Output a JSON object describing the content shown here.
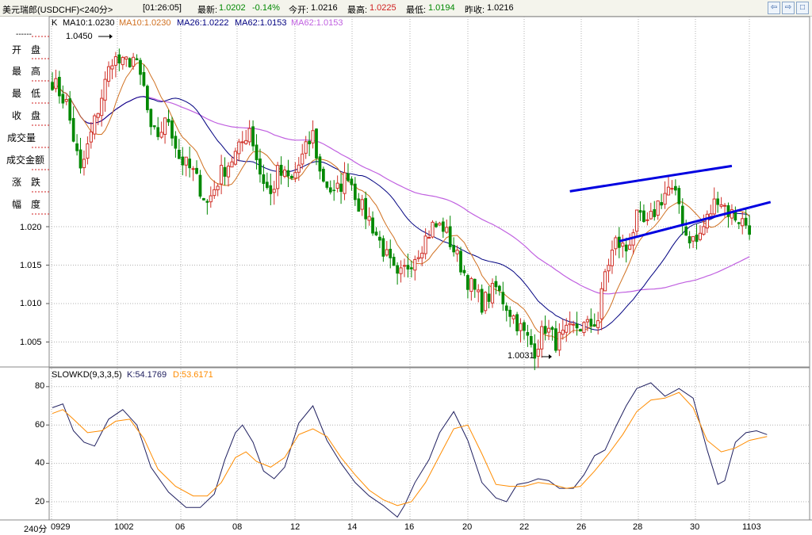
{
  "header": {
    "symbol": "美元瑞郎(USDCHF)<240分>",
    "time": "[01:26:05]",
    "latest_label": "最新:",
    "latest_value": "1.0202",
    "change": "-0.14%",
    "open_label": "今开:",
    "open_value": "1.0216",
    "high_label": "最高:",
    "high_value": "1.0225",
    "low_label": "最低:",
    "low_value": "1.0194",
    "prevclose_label": "昨收:",
    "prevclose_value": "1.0216"
  },
  "toolbar": {
    "btn1": "⇦",
    "btn2": "⇨",
    "btn3": "□"
  },
  "left_panel": {
    "dash": "------",
    "items": [
      "开　盘",
      "最　高",
      "最　低",
      "收　盘",
      "成交量",
      "成交金额",
      "涨　跌",
      "幅　度"
    ]
  },
  "ma_legend": {
    "k": "K",
    "ma10a": "MA10:1.0230",
    "ma10b": "MA10:1.0230",
    "ma26": "MA26:1.0222",
    "ma62a": "MA62:1.0153",
    "ma62b": "MA62:1.0153"
  },
  "price_annotations": {
    "high": "1.0450",
    "low": "1.0031"
  },
  "kd_legend": {
    "name": "SLOWKD(9,3,3,5)",
    "k": "K:54.1769",
    "d": "D:53.6171"
  },
  "bottom_left": "240分",
  "colors": {
    "up": "#d03028",
    "down": "#008800",
    "ma10": "#d07020",
    "ma26": "#000080",
    "ma62": "#c060e0",
    "kline": "#202060",
    "dline": "#ff8c00",
    "trendline": "#0000e0",
    "grid": "#b0b0b0"
  },
  "chart_data": [
    {
      "type": "candlestick",
      "title": "USDCHF 240分",
      "ylim": [
        1.0,
        1.047
      ],
      "yticks": [
        "1.020",
        "1.015",
        "1.010",
        "1.005"
      ],
      "xticks": [
        "0929",
        "1002",
        "06",
        "08",
        "12",
        "14",
        "16",
        "20",
        "22",
        "26",
        "28",
        "30",
        "1103"
      ],
      "waypoints": [
        {
          "i": 0,
          "c": 1.039
        },
        {
          "i": 4,
          "c": 1.036
        },
        {
          "i": 8,
          "c": 1.027
        },
        {
          "i": 11,
          "c": 1.032
        },
        {
          "i": 14,
          "c": 1.037
        },
        {
          "i": 17,
          "c": 1.042
        },
        {
          "i": 20,
          "c": 1.041
        },
        {
          "i": 23,
          "c": 1.042
        },
        {
          "i": 26,
          "c": 1.038
        },
        {
          "i": 28,
          "c": 1.032
        },
        {
          "i": 30,
          "c": 1.032
        },
        {
          "i": 33,
          "c": 1.034
        },
        {
          "i": 36,
          "c": 1.029
        },
        {
          "i": 40,
          "c": 1.027
        },
        {
          "i": 44,
          "c": 1.023
        },
        {
          "i": 48,
          "c": 1.027
        },
        {
          "i": 53,
          "c": 1.03
        },
        {
          "i": 56,
          "c": 1.033
        },
        {
          "i": 59,
          "c": 1.027
        },
        {
          "i": 62,
          "c": 1.024
        },
        {
          "i": 64,
          "c": 1.027
        },
        {
          "i": 68,
          "c": 1.026
        },
        {
          "i": 72,
          "c": 1.03
        },
        {
          "i": 74,
          "c": 1.032
        },
        {
          "i": 76,
          "c": 1.027
        },
        {
          "i": 80,
          "c": 1.024
        },
        {
          "i": 84,
          "c": 1.027
        },
        {
          "i": 87,
          "c": 1.023
        },
        {
          "i": 90,
          "c": 1.021
        },
        {
          "i": 94,
          "c": 1.017
        },
        {
          "i": 98,
          "c": 1.013
        },
        {
          "i": 101,
          "c": 1.015
        },
        {
          "i": 104,
          "c": 1.017
        },
        {
          "i": 108,
          "c": 1.02
        },
        {
          "i": 111,
          "c": 1.02
        },
        {
          "i": 115,
          "c": 1.016
        },
        {
          "i": 118,
          "c": 1.013
        },
        {
          "i": 122,
          "c": 1.01
        },
        {
          "i": 126,
          "c": 1.012
        },
        {
          "i": 130,
          "c": 1.009
        },
        {
          "i": 134,
          "c": 1.006
        },
        {
          "i": 137,
          "c": 1.004
        },
        {
          "i": 140,
          "c": 1.007
        },
        {
          "i": 143,
          "c": 1.005
        },
        {
          "i": 146,
          "c": 1.006
        },
        {
          "i": 149,
          "c": 1.007
        },
        {
          "i": 152,
          "c": 1.007
        },
        {
          "i": 155,
          "c": 1.008
        },
        {
          "i": 157,
          "c": 1.014
        },
        {
          "i": 160,
          "c": 1.018
        },
        {
          "i": 163,
          "c": 1.017
        },
        {
          "i": 166,
          "c": 1.021
        },
        {
          "i": 169,
          "c": 1.02
        },
        {
          "i": 172,
          "c": 1.023
        },
        {
          "i": 175,
          "c": 1.025
        },
        {
          "i": 178,
          "c": 1.023
        },
        {
          "i": 180,
          "c": 1.019
        },
        {
          "i": 183,
          "c": 1.018
        },
        {
          "i": 186,
          "c": 1.021
        },
        {
          "i": 189,
          "c": 1.024
        },
        {
          "i": 192,
          "c": 1.022
        },
        {
          "i": 195,
          "c": 1.021
        },
        {
          "i": 198,
          "c": 1.02
        }
      ],
      "trendlines": [
        {
          "i1": 161,
          "v1": 1.0181,
          "i2": 204,
          "v2": 1.0232
        },
        {
          "i1": 147,
          "v1": 1.0246,
          "i2": 193,
          "v2": 1.0279
        }
      ]
    },
    {
      "type": "line",
      "title": "SLOWKD(9,3,3,5)",
      "ylim": [
        10,
        85
      ],
      "yticks": [
        80,
        60,
        40,
        20
      ],
      "series": [
        {
          "name": "K",
          "points": [
            [
              0,
              69
            ],
            [
              3,
              71
            ],
            [
              6,
              57
            ],
            [
              9,
              51
            ],
            [
              12,
              49
            ],
            [
              16,
              63
            ],
            [
              20,
              68
            ],
            [
              24,
              60
            ],
            [
              28,
              38
            ],
            [
              33,
              25
            ],
            [
              38,
              17
            ],
            [
              42,
              17
            ],
            [
              46,
              24
            ],
            [
              49,
              42
            ],
            [
              52,
              56
            ],
            [
              54,
              60
            ],
            [
              57,
              51
            ],
            [
              60,
              36
            ],
            [
              63,
              32
            ],
            [
              66,
              38
            ],
            [
              70,
              61
            ],
            [
              74,
              70
            ],
            [
              78,
              52
            ],
            [
              82,
              40
            ],
            [
              86,
              30
            ],
            [
              90,
              23
            ],
            [
              94,
              18
            ],
            [
              98,
              12
            ],
            [
              100,
              18
            ],
            [
              103,
              30
            ],
            [
              107,
              42
            ],
            [
              110,
              56
            ],
            [
              114,
              67
            ],
            [
              118,
              52
            ],
            [
              122,
              30
            ],
            [
              126,
              22
            ],
            [
              129,
              20
            ],
            [
              132,
              29
            ],
            [
              135,
              30
            ],
            [
              138,
              32
            ],
            [
              141,
              31
            ],
            [
              144,
              27
            ],
            [
              148,
              27
            ],
            [
              151,
              34
            ],
            [
              154,
              44
            ],
            [
              157,
              47
            ],
            [
              160,
              59
            ],
            [
              163,
              70
            ],
            [
              166,
              79
            ],
            [
              170,
              82
            ],
            [
              174,
              75
            ],
            [
              178,
              79
            ],
            [
              182,
              74
            ],
            [
              186,
              47
            ],
            [
              189,
              29
            ],
            [
              191,
              31
            ],
            [
              194,
              51
            ],
            [
              197,
              56
            ],
            [
              200,
              57
            ],
            [
              203,
              55
            ]
          ]
        },
        {
          "name": "D",
          "points": [
            [
              0,
              66
            ],
            [
              3,
              68
            ],
            [
              6,
              63
            ],
            [
              10,
              56
            ],
            [
              14,
              57
            ],
            [
              18,
              62
            ],
            [
              22,
              63
            ],
            [
              26,
              53
            ],
            [
              30,
              37
            ],
            [
              35,
              28
            ],
            [
              40,
              23
            ],
            [
              44,
              23
            ],
            [
              48,
              30
            ],
            [
              52,
              43
            ],
            [
              55,
              46
            ],
            [
              58,
              41
            ],
            [
              62,
              38
            ],
            [
              66,
              43
            ],
            [
              70,
              55
            ],
            [
              74,
              58
            ],
            [
              78,
              54
            ],
            [
              82,
              43
            ],
            [
              86,
              34
            ],
            [
              90,
              26
            ],
            [
              94,
              21
            ],
            [
              98,
              18
            ],
            [
              102,
              20
            ],
            [
              106,
              30
            ],
            [
              110,
              44
            ],
            [
              114,
              58
            ],
            [
              118,
              60
            ],
            [
              122,
              45
            ],
            [
              126,
              29
            ],
            [
              130,
              28
            ],
            [
              134,
              28
            ],
            [
              138,
              30
            ],
            [
              142,
              29
            ],
            [
              146,
              27
            ],
            [
              150,
              28
            ],
            [
              154,
              36
            ],
            [
              158,
              45
            ],
            [
              162,
              55
            ],
            [
              166,
              67
            ],
            [
              170,
              73
            ],
            [
              174,
              74
            ],
            [
              178,
              77
            ],
            [
              182,
              69
            ],
            [
              186,
              52
            ],
            [
              190,
              46
            ],
            [
              194,
              48
            ],
            [
              198,
              52
            ],
            [
              203,
              54
            ]
          ]
        }
      ]
    }
  ]
}
